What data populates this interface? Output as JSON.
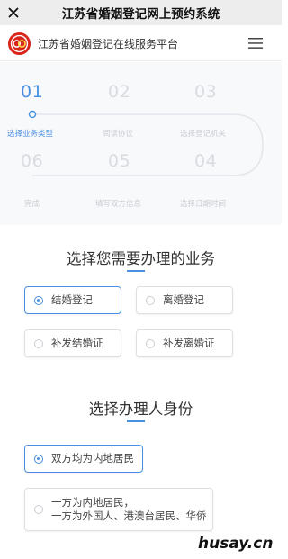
{
  "wechat_bar": {
    "title": "江苏省婚姻登记网上预约系统"
  },
  "header": {
    "site_title": "江苏省婚姻登记在线服务平台"
  },
  "steps": [
    {
      "num": "01",
      "label": "选择业务类型",
      "active": true
    },
    {
      "num": "02",
      "label": "阅读协议",
      "active": false
    },
    {
      "num": "03",
      "label": "选择登记机关",
      "active": false
    },
    {
      "num": "04",
      "label": "选择日期时间",
      "active": false
    },
    {
      "num": "05",
      "label": "填写双方信息",
      "active": false
    },
    {
      "num": "06",
      "label": "完成",
      "active": false
    }
  ],
  "business": {
    "title": "选择您需要办理的业务",
    "options": [
      {
        "label": "结婚登记",
        "selected": true
      },
      {
        "label": "离婚登记",
        "selected": false
      },
      {
        "label": "补发结婚证",
        "selected": false
      },
      {
        "label": "补发离婚证",
        "selected": false
      }
    ]
  },
  "identity": {
    "title": "选择办理人身份",
    "options": [
      {
        "label": "双方均为内地居民",
        "selected": true
      },
      {
        "line1": "一方为内地居民，",
        "line2": "一方为外国人、港澳台居民、华侨",
        "selected": false
      }
    ]
  },
  "watermark": "husay.cn",
  "colors": {
    "accent": "#4a90e2",
    "inactive": "#d8dbe0",
    "logo_red": "#d9251c"
  }
}
